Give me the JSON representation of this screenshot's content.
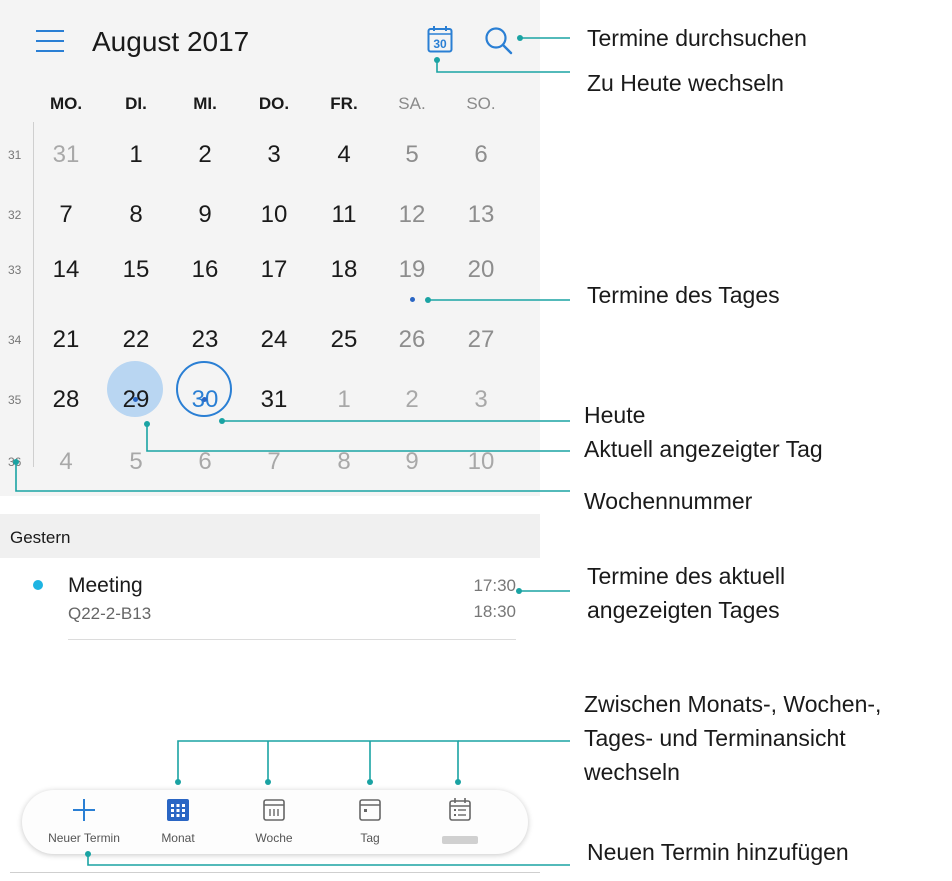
{
  "header": {
    "title": "August 2017",
    "menu_icon": "menu-icon",
    "today_icon_day": "30",
    "search_icon": "search-icon"
  },
  "weekdays": [
    "MO.",
    "DI.",
    "MI.",
    "DO.",
    "FR.",
    "SA.",
    "SO."
  ],
  "weeks": [
    {
      "number": "31",
      "days": [
        "31",
        "1",
        "2",
        "3",
        "4",
        "5",
        "6"
      ]
    },
    {
      "number": "32",
      "days": [
        "7",
        "8",
        "9",
        "10",
        "11",
        "12",
        "13"
      ]
    },
    {
      "number": "33",
      "days": [
        "14",
        "15",
        "16",
        "17",
        "18",
        "19",
        "20"
      ]
    },
    {
      "number": "34",
      "days": [
        "21",
        "22",
        "23",
        "24",
        "25",
        "26",
        "27"
      ]
    },
    {
      "number": "35",
      "days": [
        "28",
        "29",
        "30",
        "31",
        "1",
        "2",
        "3"
      ]
    },
    {
      "number": "36",
      "days": [
        "4",
        "5",
        "6",
        "7",
        "8",
        "9",
        "10"
      ]
    }
  ],
  "today": "29",
  "selected_day": "30",
  "section_header": "Gestern",
  "event": {
    "title": "Meeting",
    "location": "Q22-2-B13",
    "start": "17:30",
    "end": "18:30",
    "color": "#1eb4e2"
  },
  "bottom_bar": {
    "new_event": "Neuer Termin",
    "month": "Monat",
    "week": "Woche",
    "day": "Tag"
  },
  "callouts": {
    "search": "Termine durchsuchen",
    "go_today": "Zu Heute wechseln",
    "day_events": "Termine des Tages",
    "today": "Heute",
    "current_day": "Aktuell angezeigter Tag",
    "week_number": "Wochennummer",
    "current_events_1": "Termine des aktuell",
    "current_events_2": "angezeigten Tages",
    "switch_1": "Zwischen Monats-, Wochen-,",
    "switch_2": "Tages- und Terminansicht",
    "switch_3": "wechseln",
    "add_event": "Neuen Termin hinzufügen"
  },
  "colors": {
    "accent": "#2a7fd4",
    "callout_line": "#1aa3a3",
    "today_fill": "#b9d6f2"
  }
}
